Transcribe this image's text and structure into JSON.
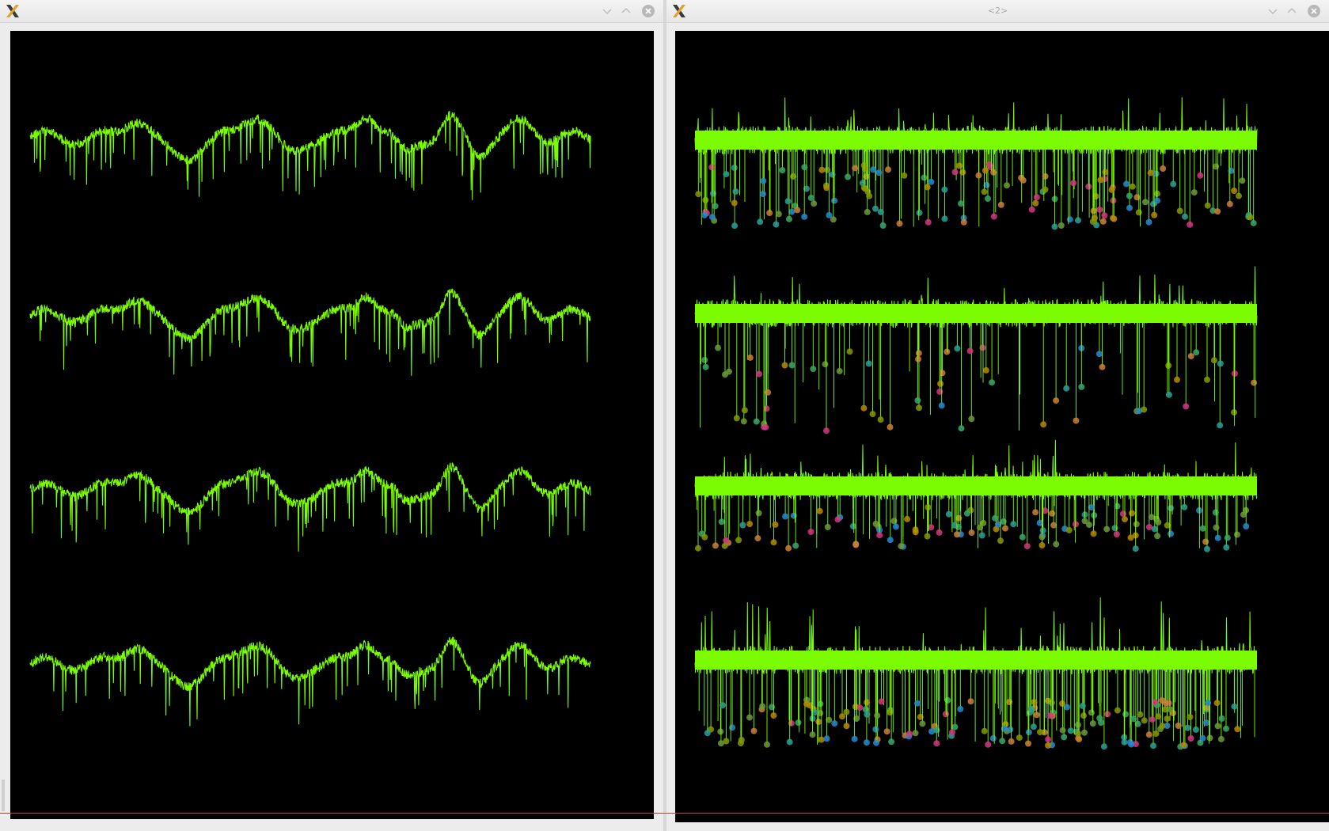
{
  "windows": [
    {
      "id": "left",
      "title": "",
      "traces": 4
    },
    {
      "id": "right",
      "title": "<2>",
      "traces": 4
    }
  ],
  "colors": {
    "trace": "#7cfc00",
    "background": "#000000",
    "marker_palette": [
      "#2aa198",
      "#d33682",
      "#cb7f3a",
      "#268bd2",
      "#859900",
      "#6c9a3a",
      "#b58900",
      "#3aa86a"
    ]
  },
  "icons": {
    "app": "x-logo-icon",
    "minimize": "chevron-down-icon",
    "maximize": "chevron-up-icon",
    "close": "close-circle-icon"
  }
}
